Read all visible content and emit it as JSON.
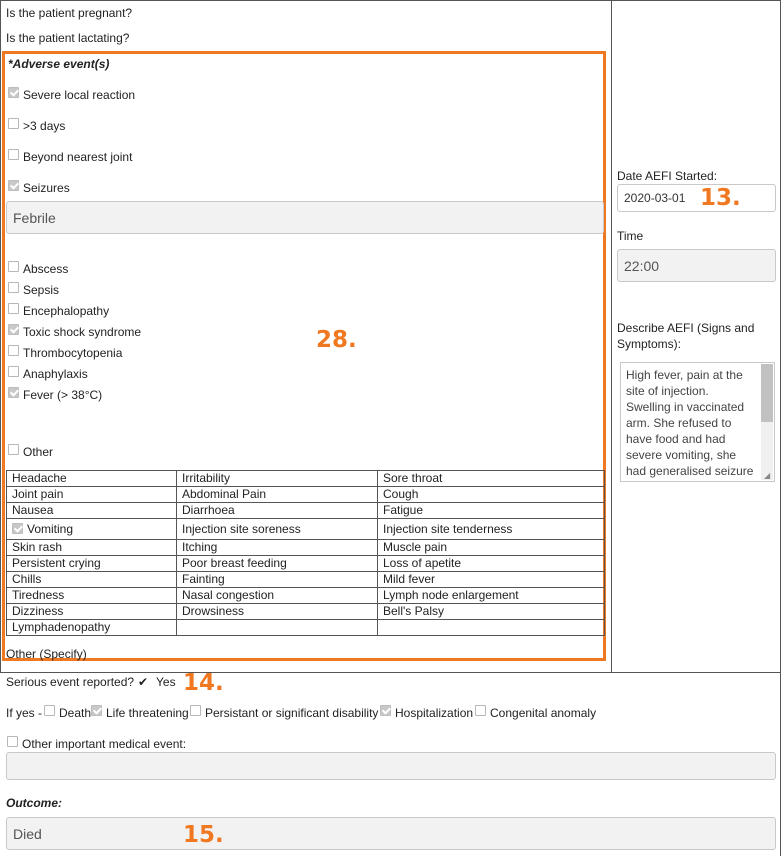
{
  "questions": {
    "pregnant": "Is the patient pregnant?",
    "lactating": "Is the patient lactating?"
  },
  "adverse": {
    "title": "*Adverse event(s)",
    "items": [
      {
        "label": "Severe local reaction",
        "checked": true
      },
      {
        "label": ">3 days",
        "checked": false
      },
      {
        "label": "Beyond nearest joint",
        "checked": false
      },
      {
        "label": "Seizures",
        "checked": true
      }
    ],
    "seizure_type": "Febrile",
    "items2": [
      {
        "label": "Abscess",
        "checked": false
      },
      {
        "label": "Sepsis",
        "checked": false
      },
      {
        "label": "Encephalopathy",
        "checked": false
      },
      {
        "label": "Toxic shock syndrome",
        "checked": true
      },
      {
        "label": "Thrombocytopenia",
        "checked": false
      },
      {
        "label": "Anaphylaxis",
        "checked": false
      },
      {
        "label": "Fever (> 38°C)",
        "checked": true
      }
    ],
    "other_label": "Other",
    "other_checked": false,
    "symptoms": [
      [
        "Headache",
        "Irritability",
        "Sore throat"
      ],
      [
        "Joint pain",
        "Abdominal Pain",
        "Cough"
      ],
      [
        "Nausea",
        "Diarrhoea",
        "Fatigue"
      ],
      [
        "Vomiting",
        "Injection site soreness",
        "Injection site tenderness"
      ],
      [
        "Skin rash",
        "Itching",
        "Muscle pain"
      ],
      [
        "Persistent crying",
        "Poor breast feeding",
        "Loss of apetite"
      ],
      [
        "Chills",
        "Fainting",
        "Mild fever"
      ],
      [
        "Tiredness",
        "Nasal congestion",
        "Lymph node enlargement"
      ],
      [
        "Dizziness",
        "Drowsiness",
        "Bell's Palsy"
      ],
      [
        "Lymphadenopathy",
        "",
        ""
      ]
    ],
    "other_specify": "Other (Specify)"
  },
  "aefi": {
    "date_label": "Date AEFI Started:",
    "date_value": "2020-03-01",
    "time_label": "Time",
    "time_value": "22:00",
    "describe_label": "Describe AEFI (Signs and Symptoms):",
    "describe_value": "High fever, pain at the site of injection. Swelling in vaccinated arm. She refused to have food and had severe vomiting, she had generalised seizure at"
  },
  "serious": {
    "label": "Serious event reported?",
    "value": "Yes",
    "if_yes": "If yes -",
    "options": [
      {
        "label": "Death",
        "checked": false
      },
      {
        "label": "Life threatening",
        "checked": true
      },
      {
        "label": "Persistant or significant disability",
        "checked": false
      },
      {
        "label": "Hospitalization",
        "checked": true
      },
      {
        "label": "Congenital anomaly",
        "checked": false
      }
    ],
    "other_label": "Other important medical event:",
    "other_value": ""
  },
  "outcome": {
    "label": "Outcome:",
    "value": "Died"
  },
  "annotations": {
    "a13": "13.",
    "a14": "14.",
    "a15": "15.",
    "a28": "28."
  },
  "colors": {
    "annotation": "#f07820"
  }
}
